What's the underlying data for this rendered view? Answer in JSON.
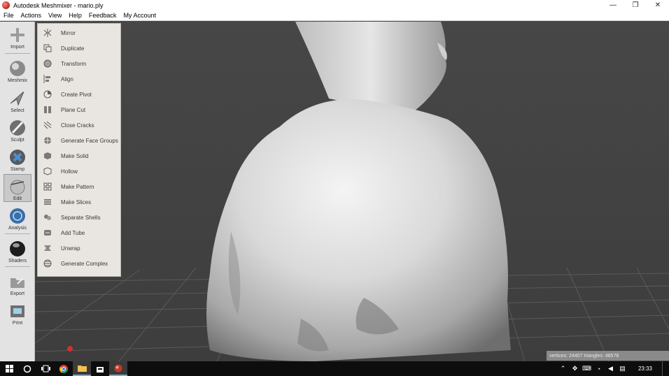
{
  "window": {
    "title": "Autodesk Meshmixer - mario.ply",
    "minimize": "—",
    "restore": "❐",
    "close": "✕"
  },
  "menubar": {
    "items": [
      "File",
      "Actions",
      "View",
      "Help",
      "Feedback",
      "My Account"
    ]
  },
  "toolbar": {
    "items": [
      {
        "label": "Import",
        "icon": "import-icon"
      },
      {
        "label": "Meshmix",
        "icon": "meshmix-icon"
      },
      {
        "label": "Select",
        "icon": "select-icon"
      },
      {
        "label": "Sculpt",
        "icon": "sculpt-icon"
      },
      {
        "label": "Stamp",
        "icon": "stamp-icon"
      },
      {
        "label": "Edit",
        "icon": "edit-icon",
        "active": true
      },
      {
        "label": "Analysis",
        "icon": "analysis-icon"
      },
      {
        "label": "Shaders",
        "icon": "shaders-icon"
      },
      {
        "label": "Export",
        "icon": "export-icon"
      },
      {
        "label": "Print",
        "icon": "print-icon"
      }
    ]
  },
  "edit_menu": {
    "items": [
      {
        "label": "Mirror",
        "icon": "mirror-icon"
      },
      {
        "label": "Duplicate",
        "icon": "duplicate-icon"
      },
      {
        "label": "Transform",
        "icon": "transform-icon"
      },
      {
        "label": "Align",
        "icon": "align-icon"
      },
      {
        "label": "Create Pivot",
        "icon": "pivot-icon"
      },
      {
        "label": "Plane Cut",
        "icon": "plane-cut-icon"
      },
      {
        "label": "Close Cracks",
        "icon": "close-cracks-icon"
      },
      {
        "label": "Generate Face Groups",
        "icon": "face-groups-icon"
      },
      {
        "label": "Make Solid",
        "icon": "make-solid-icon"
      },
      {
        "label": "Hollow",
        "icon": "hollow-icon"
      },
      {
        "label": "Make Pattern",
        "icon": "pattern-icon"
      },
      {
        "label": "Make Slices",
        "icon": "slices-icon"
      },
      {
        "label": "Separate Shells",
        "icon": "shells-icon"
      },
      {
        "label": "Add Tube",
        "icon": "tube-icon"
      },
      {
        "label": "Unwrap",
        "icon": "unwrap-icon"
      },
      {
        "label": "Generate Complex",
        "icon": "complex-icon"
      }
    ]
  },
  "status": {
    "text": "vertices: 24407 triangles: 48578"
  },
  "taskbar": {
    "clock": "23:33",
    "apps": [
      "start-icon",
      "search-icon",
      "task-view-icon",
      "chrome-icon",
      "file-explorer-icon",
      "store-icon",
      "meshmixer-icon"
    ],
    "tray": [
      "chevron-up-icon",
      "dropbox-icon",
      "language-icon",
      "network-icon",
      "volume-icon",
      "notification-icon"
    ]
  }
}
